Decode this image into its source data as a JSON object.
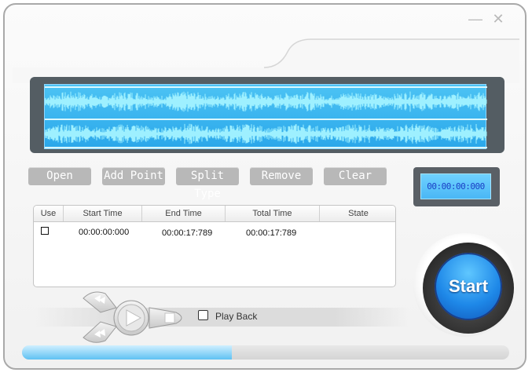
{
  "window": {
    "minimize_icon": "minimize-icon",
    "close_icon": "close-icon"
  },
  "waveform": {
    "channels": 2,
    "color": "#9ef0ff",
    "background": "#2aa7ea"
  },
  "toolbar": {
    "open_label": "Open",
    "add_point_label": "Add Point",
    "split_type_label": "Split Type",
    "remove_label": "Remove",
    "clear_label": "Clear"
  },
  "timer": {
    "display": "00:00:00:000"
  },
  "table": {
    "headers": {
      "use": "Use",
      "start_time": "Start Time",
      "end_time": "End Time",
      "total_time": "Total Time",
      "state": "State"
    },
    "rows": [
      {
        "use": false,
        "start_time": "00:00:00:000",
        "end_time": "00:00:17:789",
        "total_time": "00:00:17:789",
        "state": ""
      }
    ]
  },
  "transport": {
    "rewind_icon": "rewind-icon",
    "play_icon": "play-icon",
    "forward_icon": "forward-icon",
    "stop_icon": "stop-icon",
    "fast_forward_icon": "fast-forward-icon"
  },
  "playback": {
    "label": "Play  Back",
    "checked": false
  },
  "start_button": {
    "label": "Start"
  },
  "progress": {
    "fraction": 0.43
  },
  "colors": {
    "accent": "#1e88e8",
    "timer_text": "#1b3fc6",
    "button_gray": "#b8b8b8"
  }
}
